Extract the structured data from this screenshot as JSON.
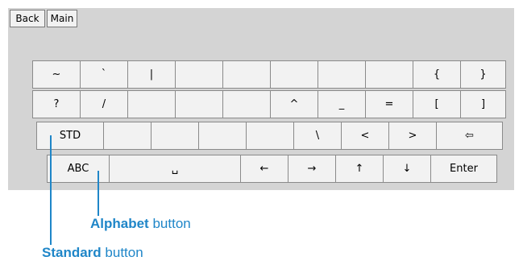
{
  "toolbar": {
    "back_label": "Back",
    "main_label": "Main"
  },
  "keyboard": {
    "row1": [
      "~",
      "`",
      "|",
      "",
      "",
      "",
      "",
      "",
      "{",
      "}"
    ],
    "row2": [
      "?",
      "/",
      "",
      "",
      "",
      "^",
      "_",
      "=",
      "[",
      "]"
    ],
    "row3": [
      "STD",
      "",
      "",
      "",
      "",
      "\\",
      "<",
      ">",
      "⇦"
    ],
    "row4": [
      "ABC",
      "␣",
      "←",
      "→",
      "↑",
      "↓",
      "Enter"
    ]
  },
  "callouts": {
    "alphabet": {
      "bold": "Alphabet",
      "rest": " button"
    },
    "standard": {
      "bold": "Standard",
      "rest": " button"
    }
  },
  "colors": {
    "callout": "#1f86c8",
    "panel": "#d4d4d4",
    "key": "#f2f2f2"
  }
}
